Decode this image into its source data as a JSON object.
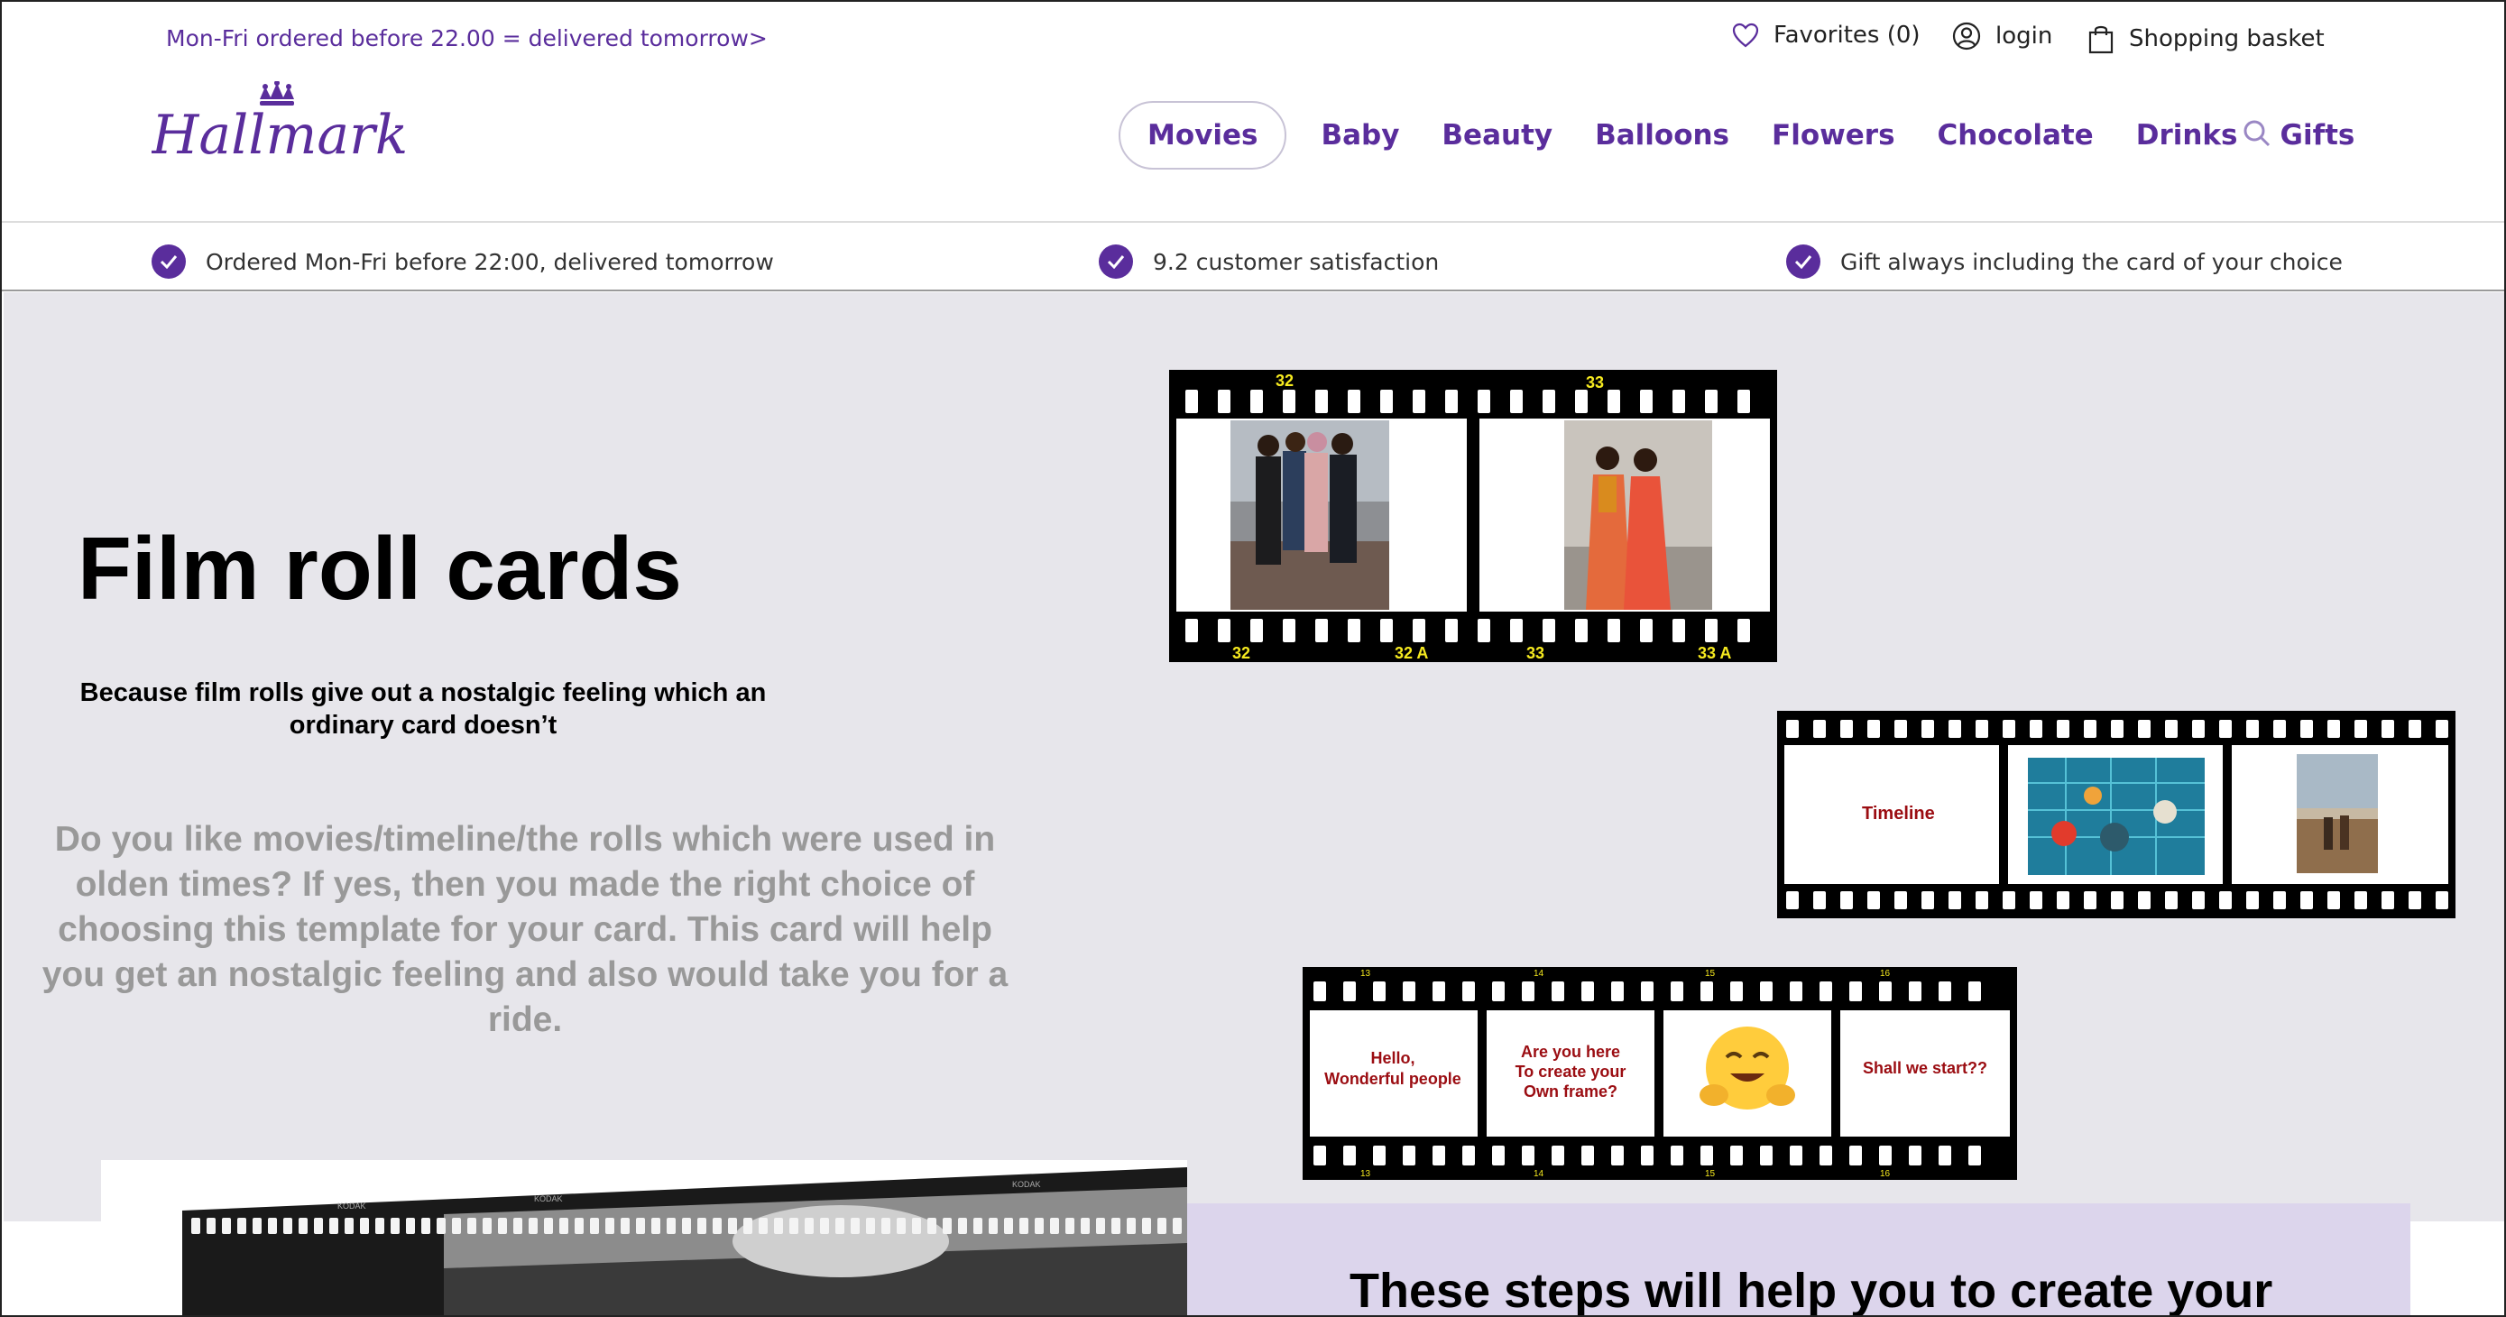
{
  "promo": {
    "text": "Mon-Fri ordered before 22.00 = delivered tomorrow>"
  },
  "utility": {
    "favorites_label": "Favorites",
    "favorites_count": "(0)",
    "login_label": "login",
    "basket_label": "Shopping basket"
  },
  "logo": {
    "text": "Hallmark"
  },
  "nav": {
    "items": [
      {
        "label": "Movies",
        "active": true
      },
      {
        "label": "Baby"
      },
      {
        "label": "Beauty"
      },
      {
        "label": "Balloons"
      },
      {
        "label": "Flowers"
      },
      {
        "label": "Chocolate"
      },
      {
        "label": "Drinks"
      },
      {
        "label": "Gifts"
      }
    ]
  },
  "usps": [
    "Ordered Mon-Fri before 22:00, delivered tomorrow",
    "9.2 customer satisfaction",
    "Gift always including the card of your choice"
  ],
  "hero": {
    "title": "Film roll cards",
    "subtitle": "Because film rolls give out a nostalgic feeling which an ordinary card doesn’t",
    "description": "Do you like movies/timeline/the rolls which were used in olden times? If yes, then you made the right choice of choosing this template for your card. This card will help you get an nostalgic feeling and also would take you for a ride."
  },
  "film_strip_1": {
    "top_numbers": [
      "32",
      "33"
    ],
    "bottom_numbers": [
      "32",
      "32 A",
      "33",
      "33 A"
    ]
  },
  "film_strip_2": {
    "frame_label": "Timeline"
  },
  "film_strip_3": {
    "numbers": [
      "13",
      "14",
      "15",
      "16"
    ],
    "frames": [
      "Hello,",
      "Wonderful people",
      "Are you here",
      "To create your",
      "Own frame?",
      "Shall we start??"
    ]
  },
  "film_strip_bottom": {
    "edge_text": [
      "KODAK",
      "KODAK",
      "KODAK"
    ]
  },
  "steps": {
    "title": "These steps will help you to create your"
  },
  "colors": {
    "brand_purple": "#5a2d9c",
    "hero_bg": "#e7e6eb",
    "film_text_red": "#9b0d12",
    "frame_number_yellow": "#f6ea1f",
    "steps_bg": "#dcd5ec"
  }
}
